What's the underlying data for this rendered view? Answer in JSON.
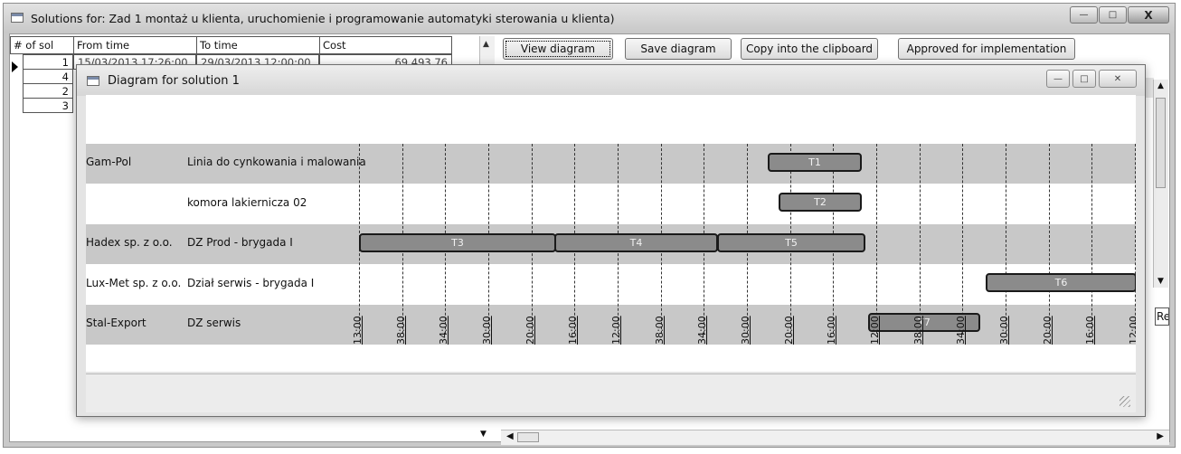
{
  "window": {
    "title": "Solutions for: Zad 1 montaż u klienta, uruchomienie i programowanie automatyki sterowania u klienta)"
  },
  "table": {
    "columns": [
      "# of sol",
      "From time",
      "To time",
      "Cost"
    ],
    "rows": [
      {
        "num": "1",
        "from": "15/03/2013 17:26:00",
        "to": "29/03/2013 12:00:00",
        "cost": "69 493,76"
      },
      {
        "num": "4"
      },
      {
        "num": "2"
      },
      {
        "num": "3"
      }
    ]
  },
  "toolbar": {
    "view_diagram": "View diagram",
    "save_diagram": "Save diagram",
    "copy_clipboard": "Copy into the clipboard",
    "approved": "Approved for implementation"
  },
  "right_panel": {
    "ref_label": "Re"
  },
  "dialog": {
    "title": "Diagram for solution 1",
    "resources": [
      {
        "company": "Gam-Pol",
        "line": "Linia do cynkowania i malowania"
      },
      {
        "company": "",
        "line": "komora lakiernicza 02"
      },
      {
        "company": "Hadex sp. z o.o.",
        "line": "DZ Prod - brygada I"
      },
      {
        "company": "Lux-Met sp. z o.o.",
        "line": "Dział serwis - brygada I"
      },
      {
        "company": "Stal-Export",
        "line": "DZ serwis"
      }
    ],
    "tasks": [
      {
        "label": "T1"
      },
      {
        "label": "T2"
      },
      {
        "label": "T3"
      },
      {
        "label": "T4"
      },
      {
        "label": "T5"
      },
      {
        "label": "T6"
      },
      {
        "label": "T7"
      }
    ],
    "time_labels": [
      "13:00",
      "38:00",
      "34:00",
      "30:00",
      "20:00",
      "16:00",
      "12:00",
      "38:00",
      "34:00",
      "30:00",
      "20:00",
      "16:00",
      "12:00",
      "38:00",
      "34:00",
      "30:00",
      "20:00",
      "16:00",
      "12:00"
    ]
  }
}
